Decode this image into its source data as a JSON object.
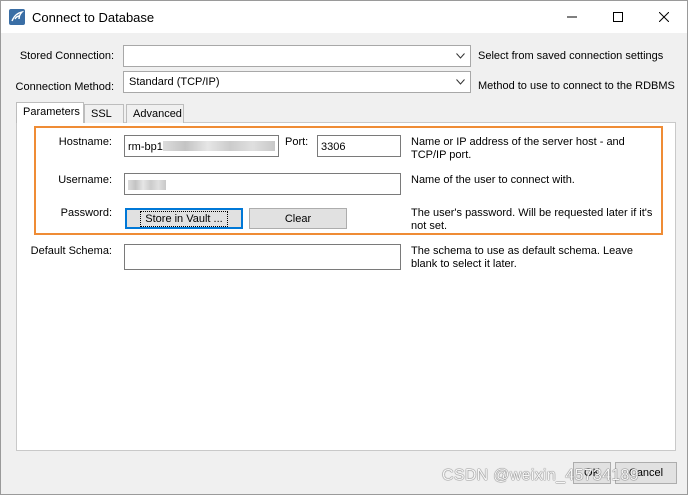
{
  "window": {
    "title": "Connect to Database"
  },
  "stored_connection": {
    "label": "Stored Connection:",
    "value": "",
    "description": "Select from saved connection settings"
  },
  "connection_method": {
    "label": "Connection Method:",
    "value": "Standard (TCP/IP)",
    "description": "Method to use to connect to the RDBMS"
  },
  "tabs": [
    {
      "label": "Parameters",
      "active": true
    },
    {
      "label": "SSL",
      "active": false
    },
    {
      "label": "Advanced",
      "active": false
    }
  ],
  "parameters": {
    "hostname": {
      "label": "Hostname:",
      "value": "rm-bp1",
      "description": "Name or IP address of the server host - and TCP/IP port."
    },
    "port": {
      "label": "Port:",
      "value": "3306"
    },
    "username": {
      "label": "Username:",
      "value": "",
      "description": "Name of the user to connect with."
    },
    "password": {
      "label": "Password:",
      "store_button": "Store in Vault ...",
      "clear_button": "Clear",
      "description": "The user's password. Will be requested later if it's not set."
    },
    "default_schema": {
      "label": "Default Schema:",
      "value": "",
      "description": "The schema to use as default schema. Leave blank to select it later."
    }
  },
  "footer": {
    "ok_label": "OK",
    "cancel_label": "Cancel",
    "watermark": "CSDN @weixin_45734189"
  },
  "colors": {
    "highlight_border": "#ef8c35",
    "focus_border": "#0078d7"
  }
}
